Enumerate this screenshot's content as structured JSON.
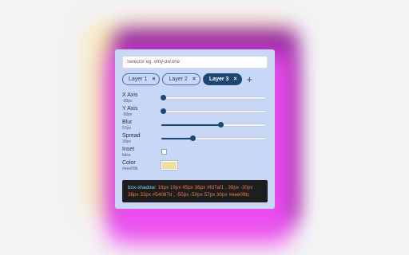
{
  "selector": {
    "placeholder": "Selector eg. #my-div.one"
  },
  "layers": [
    {
      "label": "Layer 1",
      "close": "×",
      "active": false
    },
    {
      "label": "Layer 2",
      "close": "×",
      "active": false
    },
    {
      "label": "Layer 3",
      "close": "×",
      "active": true
    }
  ],
  "add_layer": "+",
  "controls": {
    "x_axis": {
      "label": "X Axis",
      "value": "-30px",
      "level": 0.02
    },
    "y_axis": {
      "label": "Y Axis",
      "value": "-50px",
      "level": 0.02
    },
    "blur": {
      "label": "Blur",
      "value": "57px",
      "level": 0.57
    },
    "spread": {
      "label": "Spread",
      "value": "30px",
      "level": 0.3
    },
    "inset": {
      "label": "Inset",
      "value": "false",
      "checked": false
    },
    "color": {
      "label": "Color",
      "value": "#eee09b",
      "swatch": "#eee09b"
    }
  },
  "code": {
    "property": "box-shadow:",
    "value": "16px 19px 45px 36px #fd7af1 , 39px -30px 36px 33px #54087d , -50px -50px 57px 30px #eee09b;"
  },
  "colors": {
    "accent": "#1c4873",
    "panel": "#c9d7f6",
    "code_bg": "#1e1e1e",
    "code_text": "#f0784a",
    "code_prop": "#8fd0e8"
  }
}
